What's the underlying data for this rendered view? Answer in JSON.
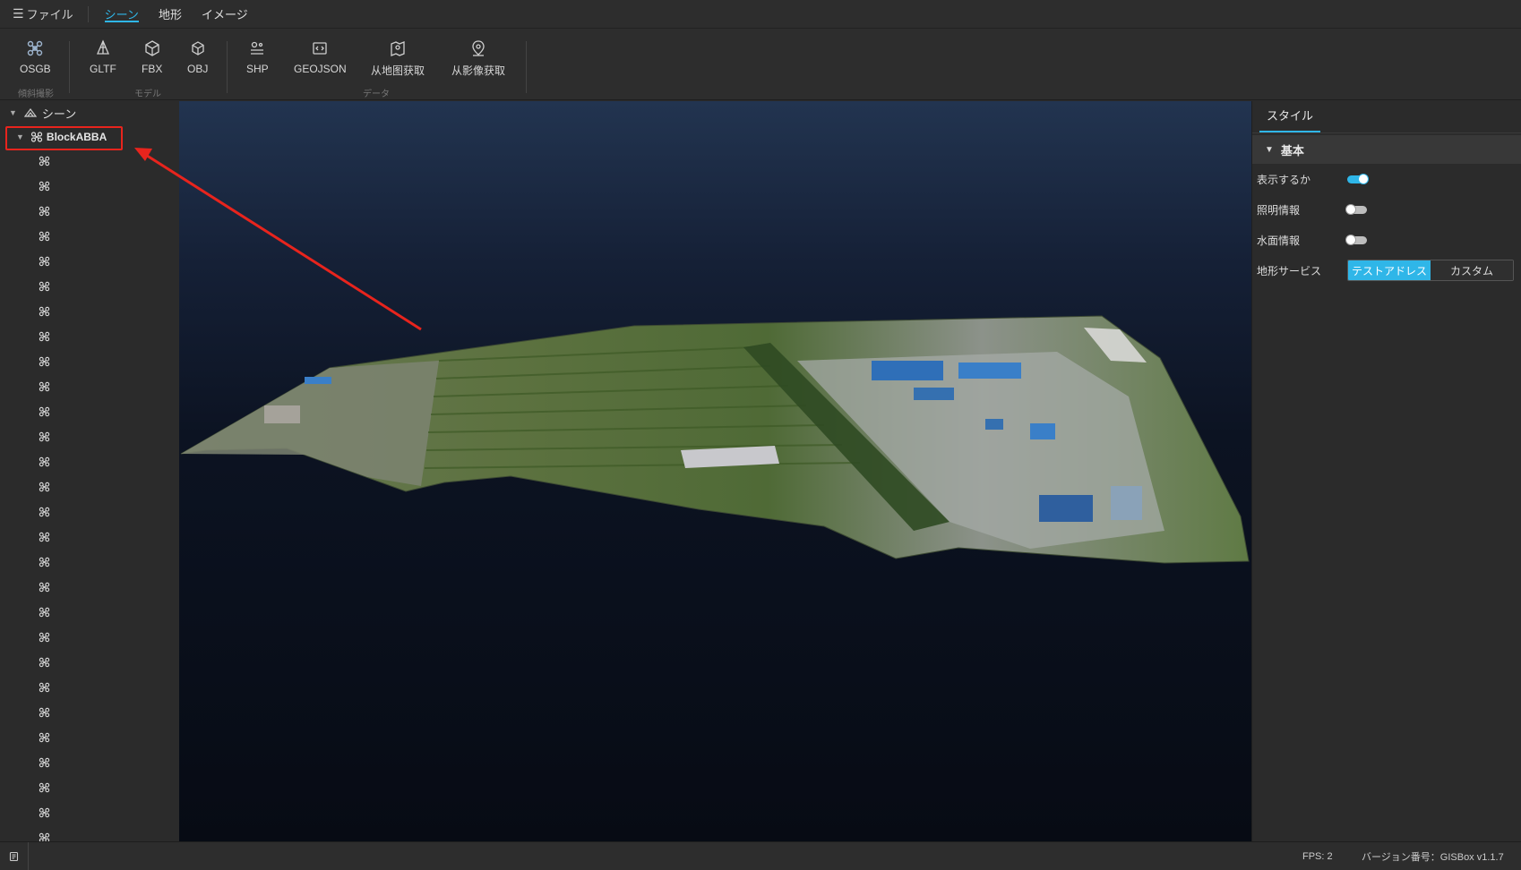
{
  "menubar": {
    "file_label": "ファイル",
    "tabs": [
      {
        "label": "シーン",
        "active": true
      },
      {
        "label": "地形",
        "active": false
      },
      {
        "label": "イメージ",
        "active": false
      }
    ]
  },
  "ribbon": {
    "buttons": [
      {
        "label": "OSGB",
        "icon": "drone-icon"
      },
      {
        "label": "GLTF",
        "icon": "gltf-icon"
      },
      {
        "label": "FBX",
        "icon": "fbx-cube-icon"
      },
      {
        "label": "OBJ",
        "icon": "obj-cube-icon"
      },
      {
        "label": "SHP",
        "icon": "shp-layers-icon"
      },
      {
        "label": "GEOJSON",
        "icon": "geojson-icon"
      },
      {
        "label": "从地图获取",
        "icon": "map-pin-icon"
      },
      {
        "label": "从影像获取",
        "icon": "image-pin-icon"
      }
    ],
    "groups": [
      "傾斜撮影",
      "モデル",
      "データ"
    ]
  },
  "tree": {
    "root_label": "シーン",
    "node_label": "BlockABBA",
    "child_count": 28
  },
  "right_panel": {
    "tab_label": "スタイル",
    "section_label": "基本",
    "rows": [
      {
        "label": "表示するか",
        "on": true
      },
      {
        "label": "照明情報",
        "on": false
      },
      {
        "label": "水面情報",
        "on": false
      }
    ],
    "terrain_label": "地形サービス",
    "terrain_options": [
      "テストアドレス",
      "カスタム"
    ],
    "terrain_selected": 0
  },
  "statusbar": {
    "fps": "FPS: 2",
    "version": "バージョン番号：GISBox v1.1.7"
  },
  "colors": {
    "accent": "#2fb6e8",
    "highlight": "#e8241d"
  }
}
